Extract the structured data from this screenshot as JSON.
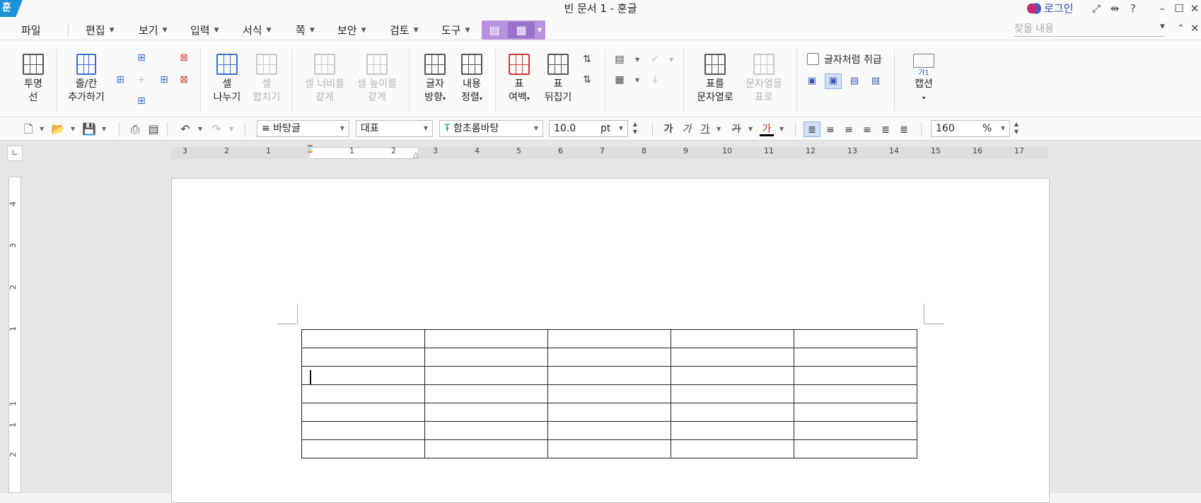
{
  "window": {
    "app_icon_label": "훈",
    "title": "빈 문서 1 - 훈글",
    "login_label": "로그인",
    "help_label": "?"
  },
  "menu": {
    "items": [
      {
        "label": "파일",
        "has_arrow": false
      },
      {
        "label": "편집",
        "has_arrow": true
      },
      {
        "label": "보기",
        "has_arrow": true
      },
      {
        "label": "입력",
        "has_arrow": true
      },
      {
        "label": "서식",
        "has_arrow": true
      },
      {
        "label": "쪽",
        "has_arrow": true
      },
      {
        "label": "보안",
        "has_arrow": true
      },
      {
        "label": "검토",
        "has_arrow": true
      },
      {
        "label": "도구",
        "has_arrow": true
      }
    ],
    "search_placeholder": "찾을 내용"
  },
  "ribbon": {
    "transparent_line": {
      "line1": "투명",
      "line2": "선"
    },
    "add_row_col": {
      "line1": "줄/칸",
      "line2": "추가하기"
    },
    "split_cell": {
      "line1": "셀",
      "line2": "나누기"
    },
    "merge_cell": {
      "line1": "셀",
      "line2": "합치기"
    },
    "equal_width": {
      "line1": "셀 너비를",
      "line2": "같게"
    },
    "equal_height": {
      "line1": "셀 높이를",
      "line2": "같게"
    },
    "text_direction": {
      "line1": "글자",
      "line2": "방향"
    },
    "content_align": {
      "line1": "내용",
      "line2": "정렬"
    },
    "table_margin": {
      "line1": "표",
      "line2": "여백"
    },
    "table_flip": {
      "line1": "표",
      "line2": "뒤집기"
    },
    "table_to_text": {
      "line1": "표를",
      "line2": "문자열로"
    },
    "text_to_table": {
      "line1": "문자열을",
      "line2": "표로"
    },
    "treat_as_char_label": "글자처럼 취급",
    "caption": {
      "line1": "캡션",
      "icon_text": "가1"
    }
  },
  "format_bar": {
    "style": "바탕글",
    "lang": "대표",
    "font": "함초롬바탕",
    "size_value": "10.0",
    "size_unit": "pt",
    "bold_label": "가",
    "italic_label": "가",
    "underline_label": "가",
    "strike_label": "가",
    "color_label": "가",
    "zoom_value": "160",
    "zoom_unit": "%"
  },
  "ruler": {
    "h_numbers": [
      "3",
      "2",
      "1",
      "1",
      "2",
      "3",
      "4",
      "5",
      "6",
      "7",
      "8",
      "9",
      "10",
      "11",
      "12",
      "13",
      "14",
      "15",
      "16",
      "17"
    ],
    "v_numbers": [
      "4",
      "3",
      "2",
      "1",
      "1",
      "1",
      "2"
    ]
  },
  "document": {
    "table": {
      "rows": 7,
      "cols": 5
    }
  }
}
